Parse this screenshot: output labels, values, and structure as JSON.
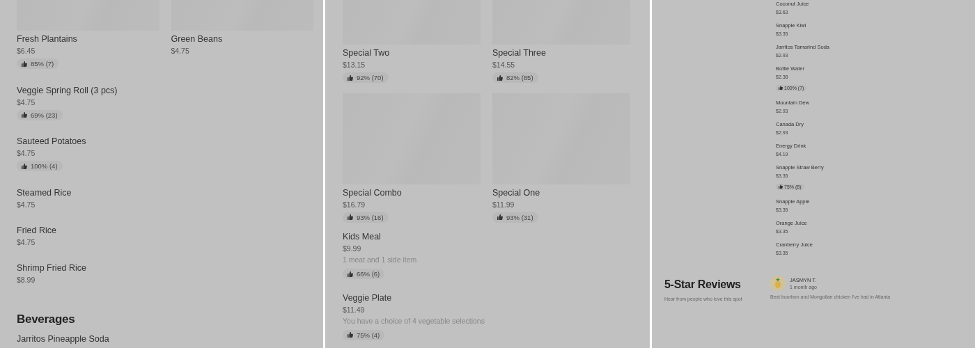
{
  "panels": [
    {
      "kind": "menu",
      "sections": [
        {
          "kind": "grid",
          "items": [
            {
              "name": "Fresh Plantains",
              "price": "$6.45",
              "rating": "85% (7)"
            },
            {
              "name": "Green Beans",
              "price": "$4.75"
            }
          ]
        },
        {
          "kind": "list",
          "items": [
            {
              "name": "Veggie Spring Roll (3 pcs)",
              "price": "$4.75",
              "rating": "69% (23)"
            },
            {
              "name": "Sauteed Potatoes",
              "price": "$4.75",
              "rating": "100% (4)"
            },
            {
              "name": "Steamed Rice",
              "price": "$4.75"
            },
            {
              "name": "Fried Rice",
              "price": "$4.75"
            },
            {
              "name": "Shrimp Fried Rice",
              "price": "$8.99"
            }
          ]
        },
        {
          "kind": "heading",
          "title": "Beverages"
        },
        {
          "kind": "list",
          "items": [
            {
              "name": "Jarritos Pineapple Soda"
            }
          ]
        }
      ]
    },
    {
      "kind": "menu",
      "sections": [
        {
          "kind": "grid",
          "items": [
            {
              "name": "Special Two",
              "price": "$13.15",
              "rating": "92% (70)"
            },
            {
              "name": "Special Three",
              "price": "$14.55",
              "rating": "82% (85)"
            },
            {
              "name": "Special Combo",
              "price": "$16.79",
              "rating": "93% (16)"
            },
            {
              "name": "Special One",
              "price": "$11.99",
              "rating": "93% (31)"
            }
          ]
        },
        {
          "kind": "list",
          "items": [
            {
              "name": "Kids Meal",
              "price": "$9.99",
              "description": "1 meat and 1 side item",
              "rating": "66% (6)"
            },
            {
              "name": "Veggie Plate",
              "price": "$11.49",
              "description": "You have a choice of 4 vegetable selections",
              "rating": "75% (4)"
            }
          ]
        }
      ]
    },
    {
      "kind": "compact",
      "sections": [
        {
          "kind": "list",
          "items": [
            {
              "name": "Coconut Juice",
              "price": "$3.63"
            },
            {
              "name": "Snapple Kiwi",
              "price": "$3.35"
            },
            {
              "name": "Jarritos Tamarind Soda",
              "price": "$2.93"
            },
            {
              "name": "Bottle Water",
              "price": "$2.38",
              "rating": "100% (7)"
            },
            {
              "name": "Mountain Dew",
              "price": "$2.93"
            },
            {
              "name": "Canada Dry",
              "price": "$2.93"
            },
            {
              "name": "Energy Drink",
              "price": "$4.19"
            },
            {
              "name": "Snapple Straw Berry",
              "price": "$3.35",
              "rating": "75% (8)"
            },
            {
              "name": "Snapple Apple",
              "price": "$3.35"
            },
            {
              "name": "Orange Juice",
              "price": "$3.35"
            },
            {
              "name": "Cranberry Juice",
              "price": "$3.35"
            }
          ]
        },
        {
          "kind": "reviews",
          "title": "5-Star Reviews",
          "subtitle": "Hear from people who love this spot",
          "reviews": [
            {
              "author": "JASMYN T.",
              "time": "1 month ago",
              "text": "Best bourbon and Mongolian chicken I've had in Atlanta"
            }
          ]
        }
      ]
    }
  ]
}
